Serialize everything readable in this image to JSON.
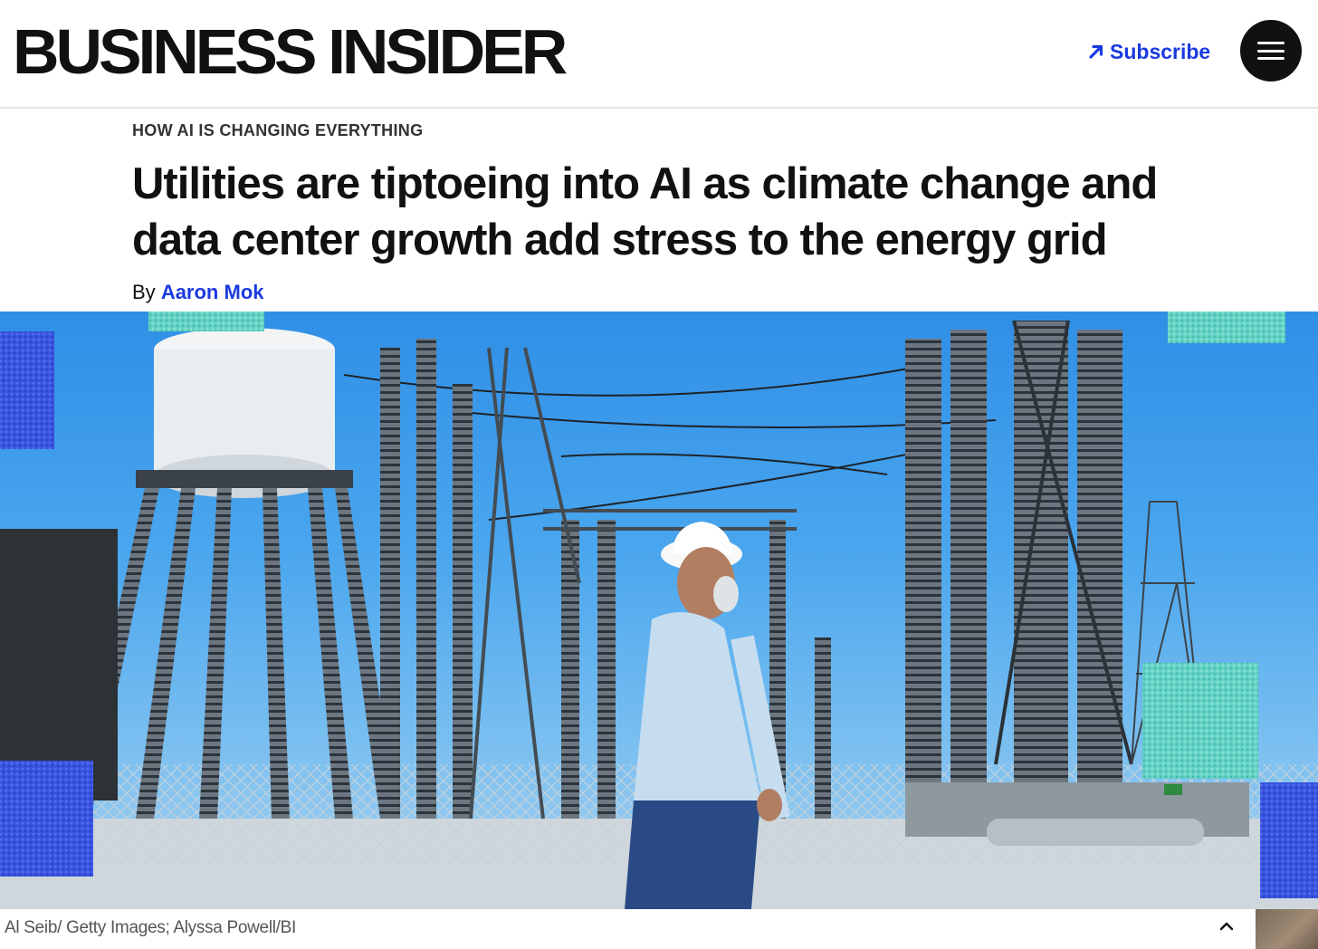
{
  "header": {
    "logo_text": "BUSINESS INSIDER",
    "subscribe_label": "Subscribe",
    "subscribe_icon": "arrow-up-right-icon",
    "menu_icon": "hamburger-menu-icon"
  },
  "article": {
    "kicker": "HOW AI IS CHANGING EVERYTHING",
    "headline": "Utilities are tiptoeing into AI as climate change and data center growth add stress to the energy grid",
    "byline_prefix": "By",
    "author": "Aaron Mok"
  },
  "hero": {
    "caption": "Al Seib/ Getty Images; Alyssa Powell/BI",
    "collapse_icon": "chevron-up-icon"
  },
  "colors": {
    "brand_blue": "#1a3ae0",
    "text_dark": "#111111",
    "sky_blue": "#4aa6ee"
  }
}
